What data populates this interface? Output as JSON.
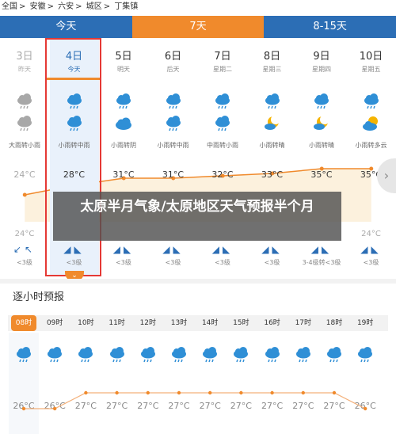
{
  "breadcrumb": {
    "items": [
      "全国",
      "安徽",
      "六安",
      "城区",
      "丁集镇"
    ],
    "separator": ">"
  },
  "tabs": [
    {
      "label": "今天",
      "active": false
    },
    {
      "label": "7天",
      "active": true
    },
    {
      "label": "8-15天",
      "active": false
    }
  ],
  "days": [
    {
      "date": "3日",
      "weekday": "昨天",
      "icon_day": "rain-cloud-icon",
      "icon_night": "rain-cloud-icon",
      "condition": "大雨转小雨",
      "high": "24°C",
      "low": "24°C",
      "wind_dir": "↙↖",
      "wind_level": "<3级",
      "state": "past"
    },
    {
      "date": "4日",
      "weekday": "今天",
      "icon_day": "rain-cloud-icon",
      "icon_night": "rain-cloud-icon",
      "condition": "小雨转中雨",
      "high": "28°C",
      "low": "",
      "wind_dir": "◢◣",
      "wind_level": "<3级",
      "state": "today"
    },
    {
      "date": "5日",
      "weekday": "明天",
      "icon_day": "rain-cloud-icon",
      "icon_night": "cloud-icon",
      "condition": "小雨转阴",
      "high": "31°C",
      "low": "",
      "wind_dir": "◢◣",
      "wind_level": "<3级",
      "state": "future"
    },
    {
      "date": "6日",
      "weekday": "后天",
      "icon_day": "rain-cloud-icon",
      "icon_night": "rain-cloud-icon",
      "condition": "小雨转中雨",
      "high": "31°C",
      "low": "",
      "wind_dir": "◢◣",
      "wind_level": "<3级",
      "state": "future"
    },
    {
      "date": "7日",
      "weekday": "星期二",
      "icon_day": "rain-cloud-icon",
      "icon_night": "rain-cloud-icon",
      "condition": "中雨转小雨",
      "high": "32°C",
      "low": "",
      "wind_dir": "◢◣",
      "wind_level": "<3级",
      "state": "future"
    },
    {
      "date": "8日",
      "weekday": "星期三",
      "icon_day": "rain-cloud-icon",
      "icon_night": "moon-cloud-icon",
      "condition": "小雨转晴",
      "high": "33°C",
      "low": "",
      "wind_dir": "◢◣",
      "wind_level": "<3级",
      "state": "future"
    },
    {
      "date": "9日",
      "weekday": "星期四",
      "icon_day": "rain-cloud-icon",
      "icon_night": "moon-cloud-icon",
      "condition": "小雨转晴",
      "high": "35°C",
      "low": "",
      "wind_dir": "◢◣",
      "wind_level": "3-4级转<3级",
      "state": "future"
    },
    {
      "date": "10日",
      "weekday": "星期五",
      "icon_day": "rain-cloud-icon",
      "icon_night": "sun-cloud-icon",
      "condition": "小雨转多云",
      "high": "35°C",
      "low": "24°C",
      "wind_dir": "◢◣",
      "wind_level": "<3级",
      "state": "future"
    }
  ],
  "banner": {
    "text": "太原半月气象/太原地区天气预报半个月"
  },
  "next_arrow": "›",
  "hourly": {
    "title": "逐小时预报",
    "hours": [
      "08时",
      "09时",
      "10时",
      "11时",
      "12时",
      "13时",
      "14时",
      "15时",
      "16时",
      "17时",
      "18时",
      "19时"
    ],
    "temps": [
      "26°C",
      "26°C",
      "27°C",
      "27°C",
      "27°C",
      "27°C",
      "27°C",
      "27°C",
      "27°C",
      "27°C",
      "27°C",
      "26°C"
    ],
    "temp_values": [
      26,
      26,
      27,
      27,
      27,
      27,
      27,
      27,
      27,
      27,
      27,
      26
    ],
    "current_hour_index": 0
  },
  "colors": {
    "tab_bar": "#2c6eb5",
    "accent": "#f08a2c",
    "today_frame": "#e53935",
    "icon_blue": "#2f8fd6",
    "icon_grey": "#a8a8a8",
    "sun": "#f5b400"
  }
}
